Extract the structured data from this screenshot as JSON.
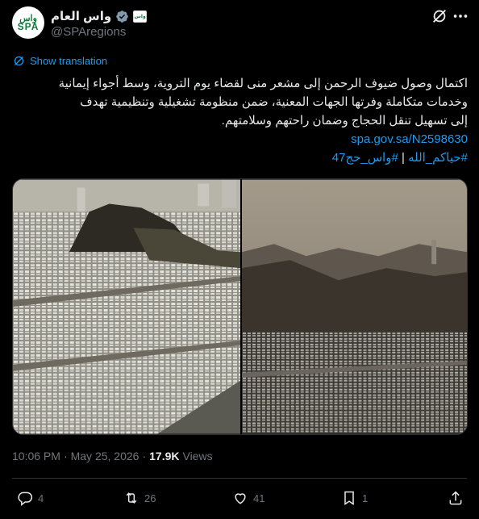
{
  "account": {
    "display_name": "واس العام",
    "handle": "@SPAregions",
    "avatar_text_top": "واس",
    "avatar_text_bottom": "SPA",
    "affiliate_badge_text": "واس"
  },
  "translate_label": "Show translation",
  "tweet": {
    "lines": [
      "اكتمال وصول ضيوف الرحمن إلى مشعر منى لقضاء يوم التروية، وسط أجواء إيمانية",
      "وخدمات متكاملة وفرتها الجهات المعنية، ضمن منظومة تشغيلية وتنظيمية تهدف",
      "إلى تسهيل تنقل الحجاج وضمان راحتهم وسلامتهم."
    ],
    "link": "spa.gov.sa/N2598630",
    "hashtag1": "#حياكم_الله",
    "separator": " | ",
    "hashtag2": "#واس_حج47"
  },
  "meta": {
    "time": "10:06 PM",
    "dot": "·",
    "date": "May 25, 2026",
    "dot2": "·",
    "views_count": "17.9K",
    "views_label": "Views"
  },
  "actions": {
    "replies": "4",
    "reposts": "26",
    "likes": "41",
    "bookmarks": "1"
  },
  "colors": {
    "background": "#000000",
    "text": "#e7e9ea",
    "muted": "#71767b",
    "link": "#1d9bf0",
    "brand_green": "#0f7a3d"
  }
}
